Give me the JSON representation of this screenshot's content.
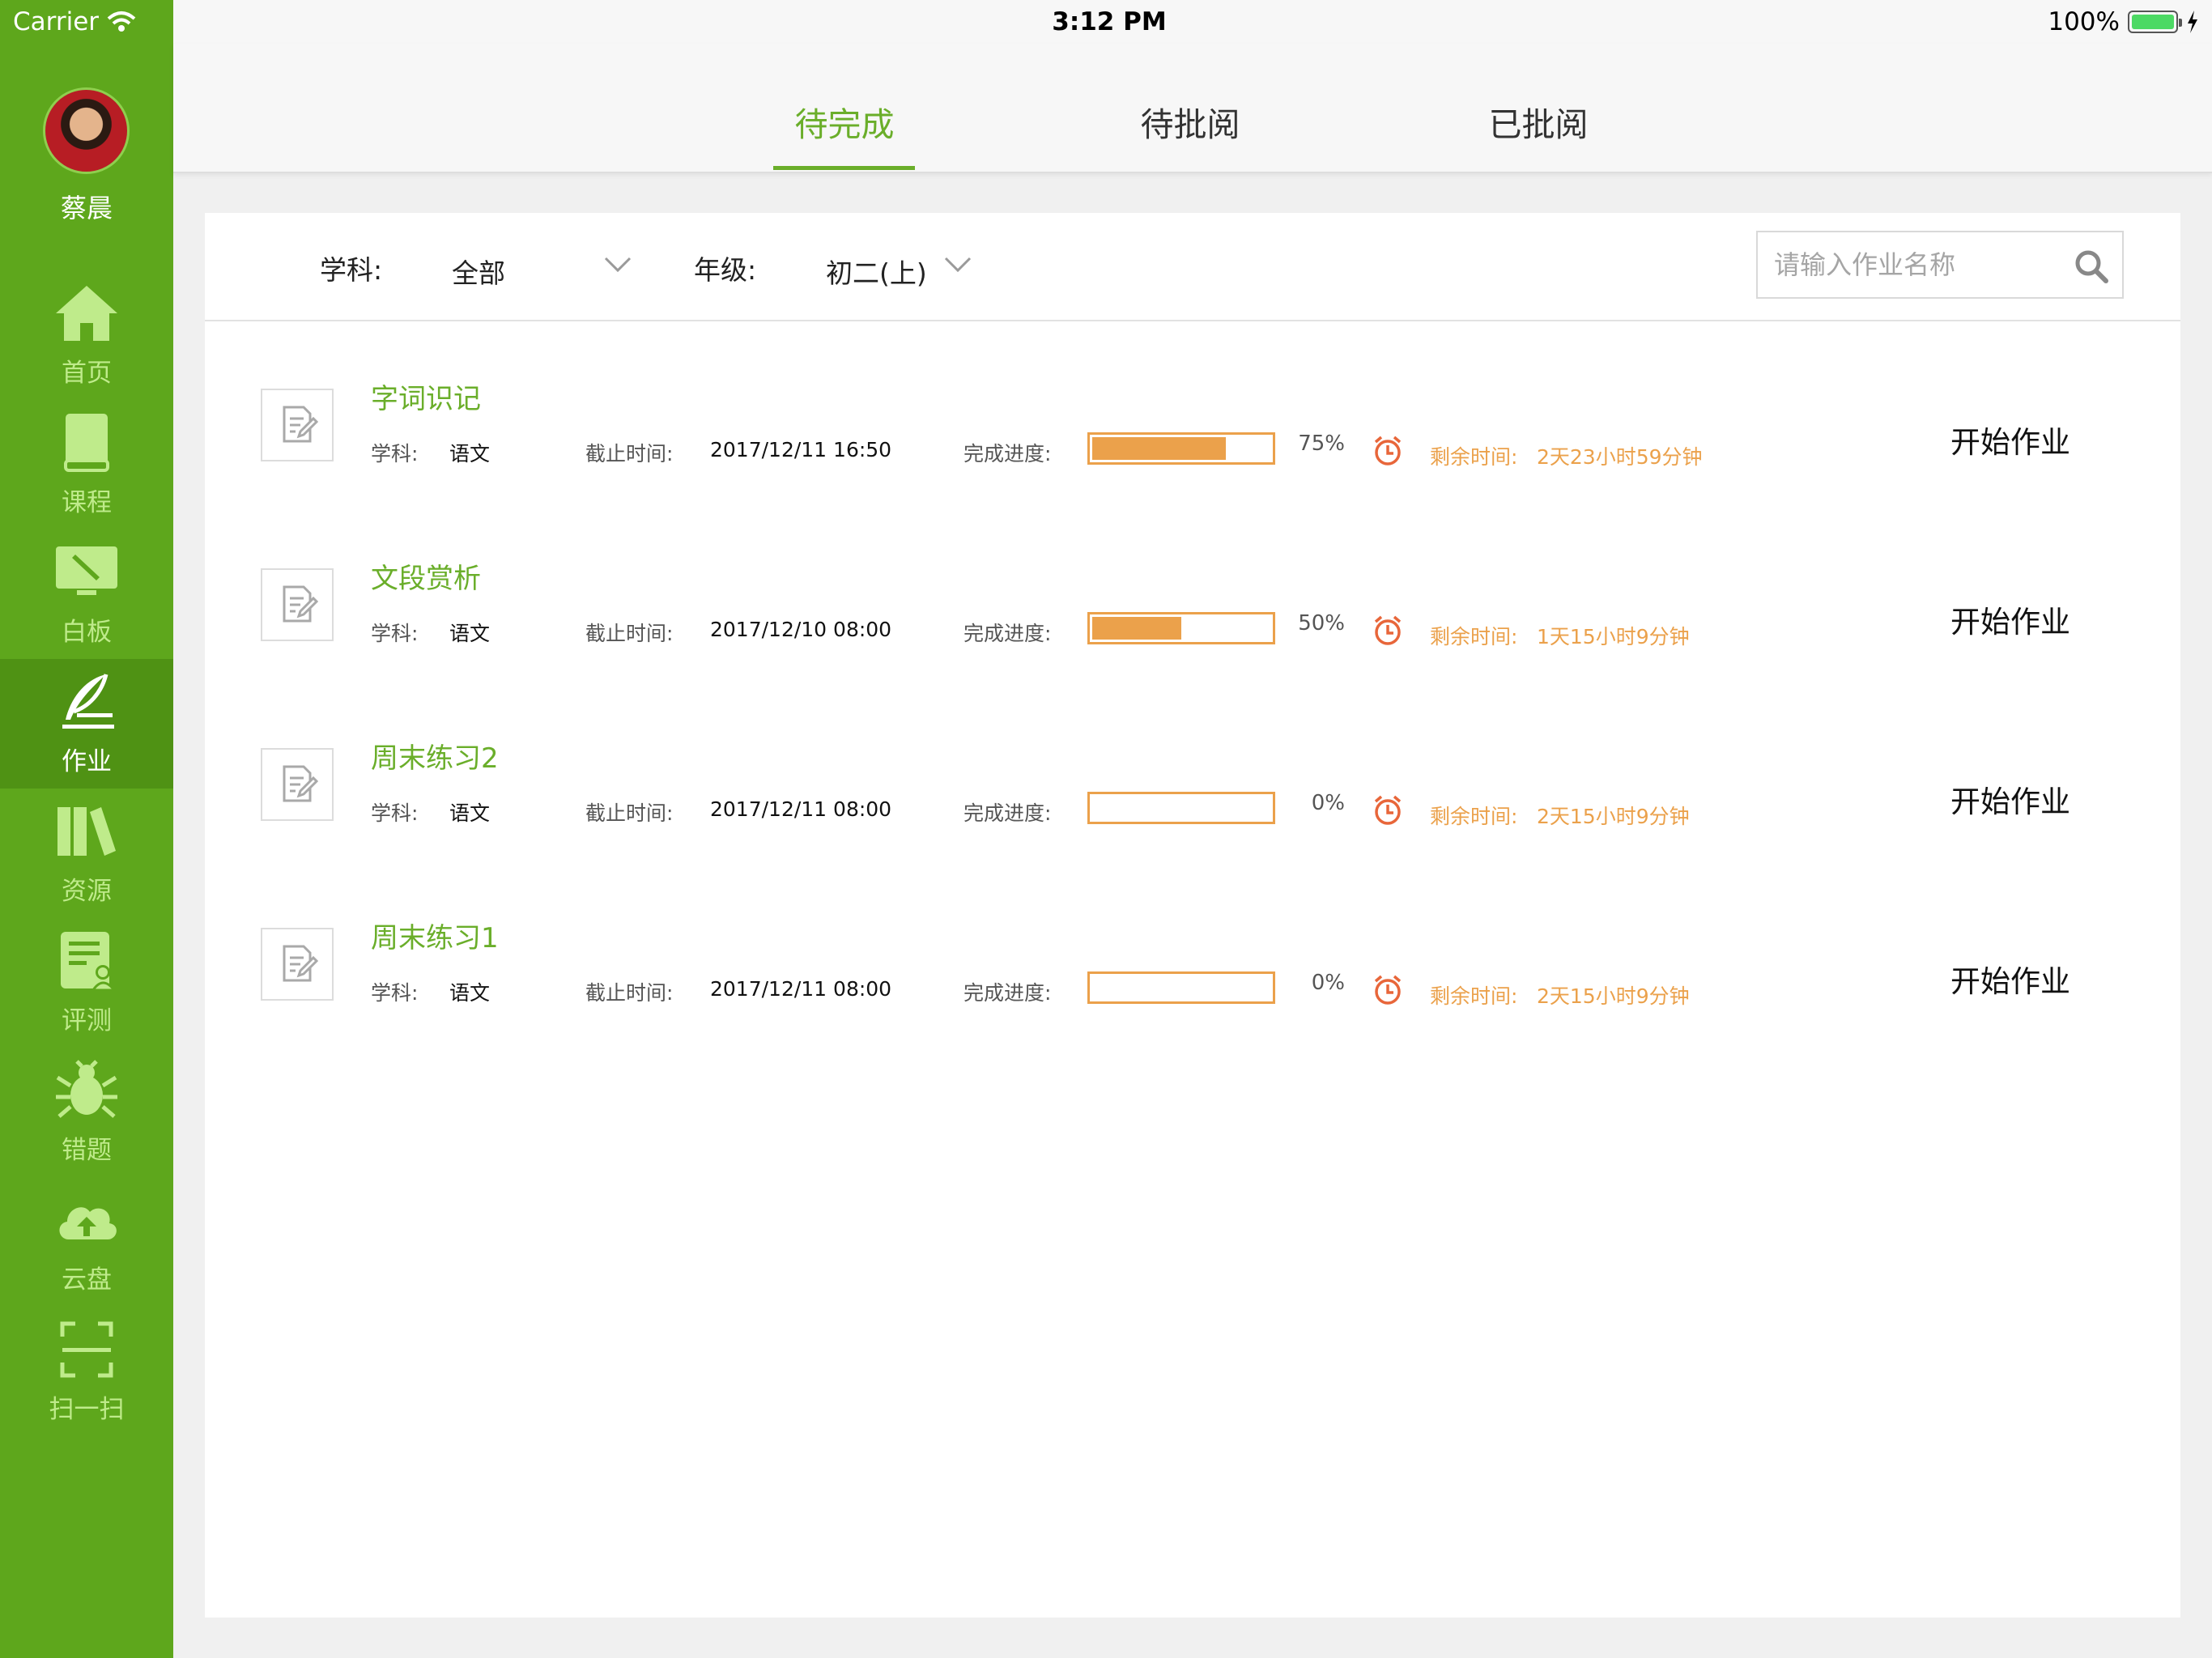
{
  "status_bar": {
    "carrier": "Carrier",
    "time": "3:12 PM",
    "battery": "100%"
  },
  "sidebar": {
    "user_name": "蔡晨",
    "items": [
      {
        "label": "首页",
        "icon": "home-icon",
        "active": false
      },
      {
        "label": "课程",
        "icon": "book-icon",
        "active": false
      },
      {
        "label": "白板",
        "icon": "whiteboard-icon",
        "active": false
      },
      {
        "label": "作业",
        "icon": "quill-pen-icon",
        "active": true
      },
      {
        "label": "资源",
        "icon": "library-books-icon",
        "active": false
      },
      {
        "label": "评测",
        "icon": "test-icon",
        "active": false
      },
      {
        "label": "错题",
        "icon": "bug-icon",
        "active": false
      },
      {
        "label": "云盘",
        "icon": "cloud-upload-icon",
        "active": false
      },
      {
        "label": "扫一扫",
        "icon": "scan-icon",
        "active": false
      }
    ]
  },
  "tabs": [
    {
      "label": "待完成",
      "active": true
    },
    {
      "label": "待批阅",
      "active": false
    },
    {
      "label": "已批阅",
      "active": false
    }
  ],
  "filters": {
    "subject_label": "学科:",
    "subject_value": "全部",
    "grade_label": "年级:",
    "grade_value": "初二(上)",
    "search_placeholder": "请输入作业名称"
  },
  "row_labels": {
    "subject": "学科:",
    "deadline": "截止时间:",
    "progress": "完成进度:",
    "remaining": "剩余时间:",
    "start": "开始作业"
  },
  "assignments": [
    {
      "title": "字词识记",
      "subject": "语文",
      "deadline": "2017/12/11 16:50",
      "progress": 75,
      "progress_text": "75%",
      "remaining": "2天23小时59分钟"
    },
    {
      "title": "文段赏析",
      "subject": "语文",
      "deadline": "2017/12/10 08:00",
      "progress": 50,
      "progress_text": "50%",
      "remaining": "1天15小时9分钟"
    },
    {
      "title": "周末练习2",
      "subject": "语文",
      "deadline": "2017/12/11 08:00",
      "progress": 0,
      "progress_text": "0%",
      "remaining": "2天15小时9分钟"
    },
    {
      "title": "周末练习1",
      "subject": "语文",
      "deadline": "2017/12/11 08:00",
      "progress": 0,
      "progress_text": "0%",
      "remaining": "2天15小时9分钟"
    }
  ],
  "colors": {
    "sidebar": "#5ea71c",
    "sidebar_active": "#4f9214",
    "accent_green": "#6aae2a",
    "progress_orange": "#eba14b",
    "timer_red": "#e8663a"
  }
}
